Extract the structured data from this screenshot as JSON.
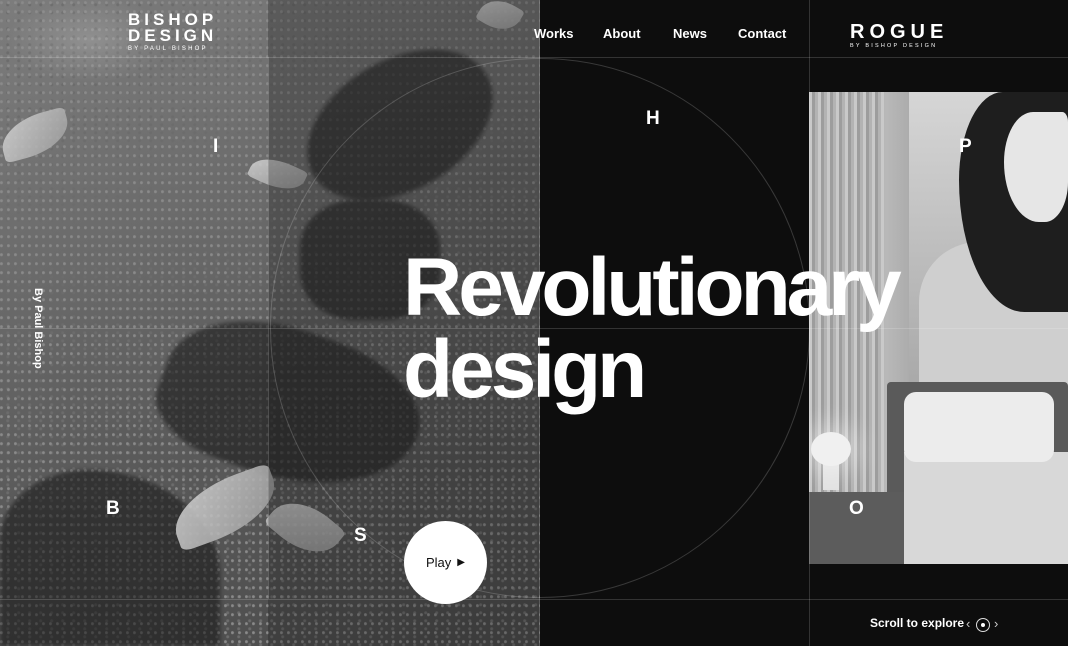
{
  "brand": {
    "line1": "BISHOP",
    "line2": "DESIGN",
    "tagline": "BY PAUL BISHOP"
  },
  "nav": {
    "items": [
      "Works",
      "About",
      "News",
      "Contact"
    ]
  },
  "partner_logo": {
    "name": "ROGUE",
    "tagline": "BY BISHOP DESIGN"
  },
  "letters": [
    "B",
    "I",
    "S",
    "H",
    "O",
    "P"
  ],
  "hero": {
    "line1": "Revolutionary",
    "line2": "design"
  },
  "side_text": "By Paul Bishop",
  "play": {
    "label": "Play",
    "icon": "play-icon"
  },
  "scroll": {
    "label": "Scroll to explore",
    "prev_icon": "chevron-left-icon",
    "indicator_icon": "scroll-indicator-icon",
    "next_icon": "chevron-right-icon"
  },
  "colors": {
    "background": "#0d0d0d",
    "text": "#ffffff"
  }
}
